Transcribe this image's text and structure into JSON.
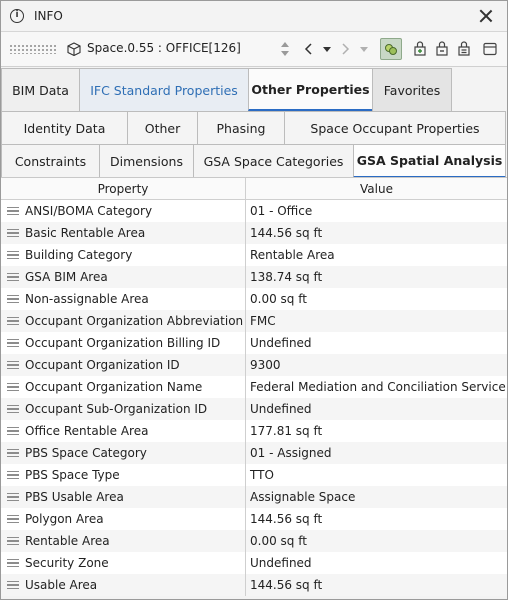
{
  "window": {
    "title": "INFO"
  },
  "toolbar": {
    "element_name": "Space.0.55 : OFFICE[126]"
  },
  "tabs_row1": [
    "BIM Data",
    "IFC Standard Properties",
    "Other Properties",
    "Favorites"
  ],
  "tabs_row2": [
    "Identity Data",
    "Other",
    "Phasing",
    "Space Occupant Properties"
  ],
  "tabs_row3": [
    "Constraints",
    "Dimensions",
    "GSA Space Categories",
    "GSA Spatial Analysis"
  ],
  "table": {
    "headers": {
      "property": "Property",
      "value": "Value"
    },
    "rows": [
      {
        "property": "ANSI/BOMA Category",
        "value": "01 - Office"
      },
      {
        "property": "Basic Rentable Area",
        "value": "144.56 sq ft"
      },
      {
        "property": "Building Category",
        "value": "Rentable Area"
      },
      {
        "property": "GSA BIM Area",
        "value": "138.74 sq ft"
      },
      {
        "property": "Non-assignable Area",
        "value": "0.00 sq ft"
      },
      {
        "property": "Occupant Organization Abbreviation",
        "value": "FMC"
      },
      {
        "property": "Occupant Organization Billing ID",
        "value": "Undefined"
      },
      {
        "property": "Occupant Organization ID",
        "value": "9300"
      },
      {
        "property": "Occupant Organization Name",
        "value": "Federal Mediation and Conciliation Service"
      },
      {
        "property": "Occupant Sub-Organization ID",
        "value": "Undefined"
      },
      {
        "property": "Office Rentable Area",
        "value": "177.81 sq ft"
      },
      {
        "property": "PBS Space Category",
        "value": "01 - Assigned"
      },
      {
        "property": "PBS Space Type",
        "value": "TTO"
      },
      {
        "property": "PBS Usable Area",
        "value": "Assignable Space"
      },
      {
        "property": "Polygon Area",
        "value": "144.56 sq ft"
      },
      {
        "property": "Rentable Area",
        "value": "0.00 sq ft"
      },
      {
        "property": "Security Zone",
        "value": "Undefined"
      },
      {
        "property": "Usable Area",
        "value": "144.56 sq ft"
      }
    ]
  },
  "colors": {
    "accent": "#2b6cc4",
    "ifc_link": "#2f6fb5",
    "active_tool": "#c8d8c6"
  }
}
